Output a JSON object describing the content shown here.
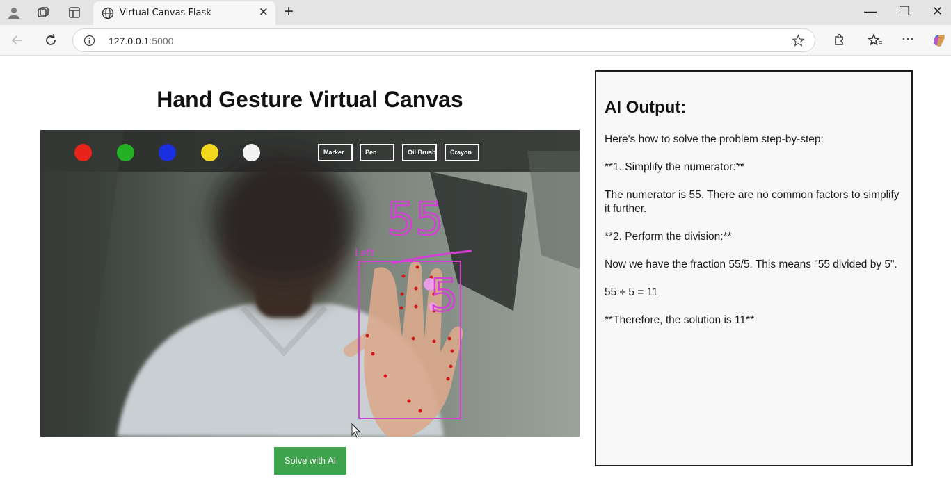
{
  "browser": {
    "tab_title": "Virtual Canvas Flask",
    "url_host": "127.0.0.1",
    "url_port": ":5000"
  },
  "page": {
    "title": "Hand Gesture Virtual Canvas",
    "solve_button": "Solve with AI"
  },
  "toolbar": {
    "colors": [
      {
        "name": "red",
        "hex": "#e8231a"
      },
      {
        "name": "green",
        "hex": "#22b224"
      },
      {
        "name": "blue",
        "hex": "#1a2fe0"
      },
      {
        "name": "yellow",
        "hex": "#f2d81c"
      },
      {
        "name": "white",
        "hex": "#f2f2f2"
      }
    ],
    "tools": [
      "Marker",
      "Pen",
      "Oil Brush",
      "Crayon"
    ]
  },
  "canvas": {
    "handedness_label": "Left",
    "drawn_numerator": "55",
    "drawn_denominator": "5",
    "ink_color": "#d63fd6"
  },
  "ai_output": {
    "heading": "AI Output:",
    "lines": [
      "Here's how to solve the problem step-by-step:",
      "**1. Simplify the numerator:**",
      "The numerator is 55. There are no common factors to simplify it further.",
      "**2. Perform the division:**",
      "Now we have the fraction 55/5. This means \"55 divided by 5\".",
      "55 ÷ 5 = 11",
      "**Therefore, the solution is 11**"
    ]
  }
}
